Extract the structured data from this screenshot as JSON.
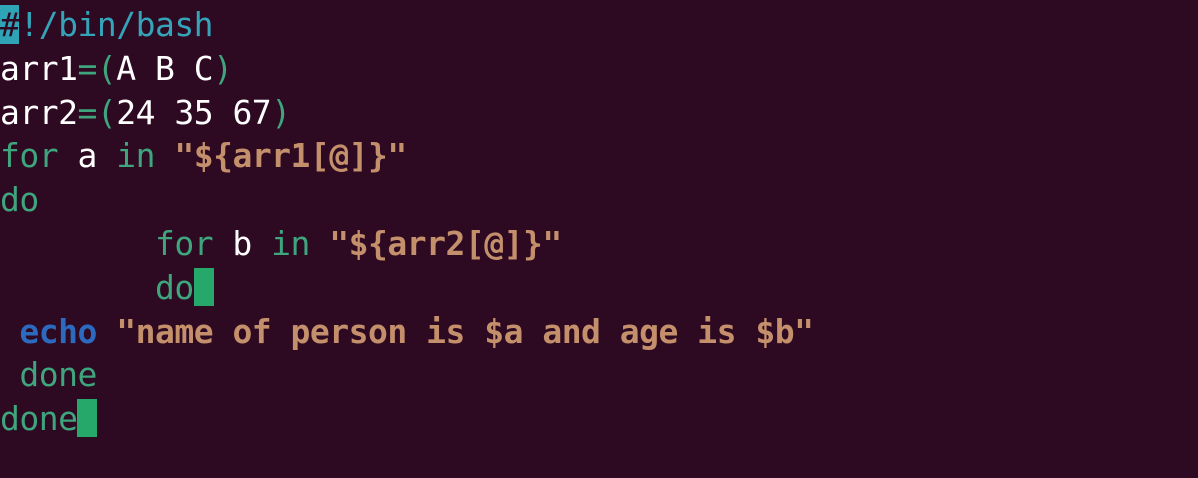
{
  "colors": {
    "background": "#2d0922",
    "plain": "#ffffff",
    "keyword": "#3ea57d",
    "string": "#c4906b",
    "builtin": "#2c6ac0",
    "comment": "#35a3b8",
    "cursor": "#25a86a",
    "highlight": "#2ea4b6"
  },
  "editor": {
    "lines": [
      {
        "name": "shebang-line",
        "segments": [
          {
            "text": "#",
            "color": "#2d0922",
            "bg": "#2ea4b6"
          },
          {
            "text": "!/bin/bash",
            "color": "#35a3b8"
          }
        ]
      },
      {
        "name": "arr1-line",
        "segments": [
          {
            "text": "arr1",
            "color": "#ffffff"
          },
          {
            "text": "=(",
            "color": "#3ea57d"
          },
          {
            "text": "A B C",
            "color": "#ffffff"
          },
          {
            "text": ")",
            "color": "#3ea57d"
          }
        ]
      },
      {
        "name": "arr2-line",
        "segments": [
          {
            "text": "arr2",
            "color": "#ffffff"
          },
          {
            "text": "=(",
            "color": "#3ea57d"
          },
          {
            "text": "24 35 67",
            "color": "#ffffff"
          },
          {
            "text": ")",
            "color": "#3ea57d"
          }
        ]
      },
      {
        "name": "outer-for-line",
        "segments": [
          {
            "text": "for",
            "color": "#3ea57d"
          },
          {
            "text": " a ",
            "color": "#ffffff"
          },
          {
            "text": "in",
            "color": "#3ea57d"
          },
          {
            "text": " ",
            "color": "#ffffff"
          },
          {
            "text": "\"${arr1[@]}\"",
            "color": "#c4906b",
            "bold": true
          }
        ]
      },
      {
        "name": "outer-do-line",
        "segments": [
          {
            "text": "do",
            "color": "#3ea57d"
          }
        ]
      },
      {
        "name": "inner-for-line",
        "segments": [
          {
            "text": "        ",
            "color": "#ffffff"
          },
          {
            "text": "for",
            "color": "#3ea57d"
          },
          {
            "text": " b ",
            "color": "#ffffff"
          },
          {
            "text": "in",
            "color": "#3ea57d"
          },
          {
            "text": " ",
            "color": "#ffffff"
          },
          {
            "text": "\"${arr2[@]}\"",
            "color": "#c4906b",
            "bold": true
          }
        ]
      },
      {
        "name": "inner-do-line",
        "segments": [
          {
            "text": "        ",
            "color": "#ffffff"
          },
          {
            "text": "do",
            "color": "#3ea57d"
          },
          {
            "cursor": true,
            "color": "#25a86a"
          }
        ]
      },
      {
        "name": "echo-line",
        "segments": [
          {
            "text": " ",
            "color": "#ffffff"
          },
          {
            "text": "echo",
            "color": "#2c6ac0",
            "bold": true
          },
          {
            "text": " ",
            "color": "#ffffff"
          },
          {
            "text": "\"name of person is $a and age is $b\"",
            "color": "#c4906b",
            "bold": true
          }
        ]
      },
      {
        "name": "inner-done-line",
        "segments": [
          {
            "text": " ",
            "color": "#ffffff"
          },
          {
            "text": "done",
            "color": "#3ea57d"
          }
        ]
      },
      {
        "name": "outer-done-line",
        "segments": [
          {
            "text": "done",
            "color": "#3ea57d"
          },
          {
            "cursor": true,
            "color": "#25a86a"
          }
        ]
      }
    ]
  }
}
